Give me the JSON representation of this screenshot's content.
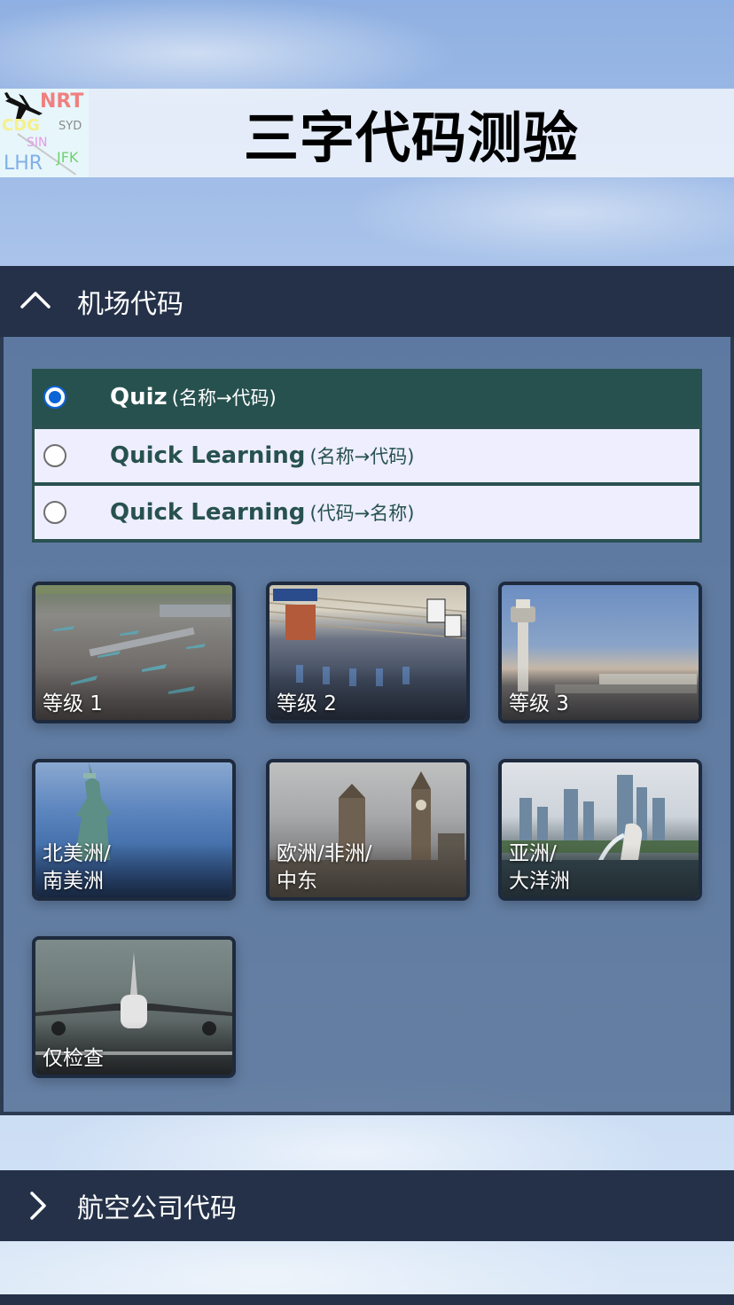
{
  "header": {
    "title": "三字代码测验",
    "logo_codes": [
      "NRT",
      "SYD",
      "CDG",
      "SIN",
      "JFK",
      "LHR"
    ]
  },
  "airport_section": {
    "label": "机场代码",
    "expanded": true,
    "mode_options": [
      {
        "main": "Quiz",
        "sub": "(名称→代码)",
        "selected": true
      },
      {
        "main": "Quick Learning",
        "sub": "(名称→代码)",
        "selected": false
      },
      {
        "main": "Quick Learning",
        "sub": "(代码→名称)",
        "selected": false
      }
    ],
    "tiles": [
      {
        "line1": "等级 1",
        "line2": "",
        "image": "airport-apron-photo"
      },
      {
        "line1": "等级 2",
        "line2": "",
        "image": "terminal-checkin-photo"
      },
      {
        "line1": "等级 3",
        "line2": "",
        "image": "control-tower-photo"
      },
      {
        "line1": "北美洲/",
        "line2": "南美洲",
        "image": "statue-of-liberty-photo"
      },
      {
        "line1": "欧洲/非洲/",
        "line2": "中东",
        "image": "big-ben-photo"
      },
      {
        "line1": "亚洲/",
        "line2": "大洋洲",
        "image": "singapore-merlion-photo"
      },
      {
        "line1": "仅检查",
        "line2": "",
        "image": "airplane-landing-photo"
      }
    ]
  },
  "airline_section": {
    "label": "航空公司代码",
    "expanded": false
  },
  "colors": {
    "header_bar": "#243148",
    "selected_option": "#27514f",
    "option_bg": "#eeeefe",
    "radio_accent": "#0a64d6"
  }
}
